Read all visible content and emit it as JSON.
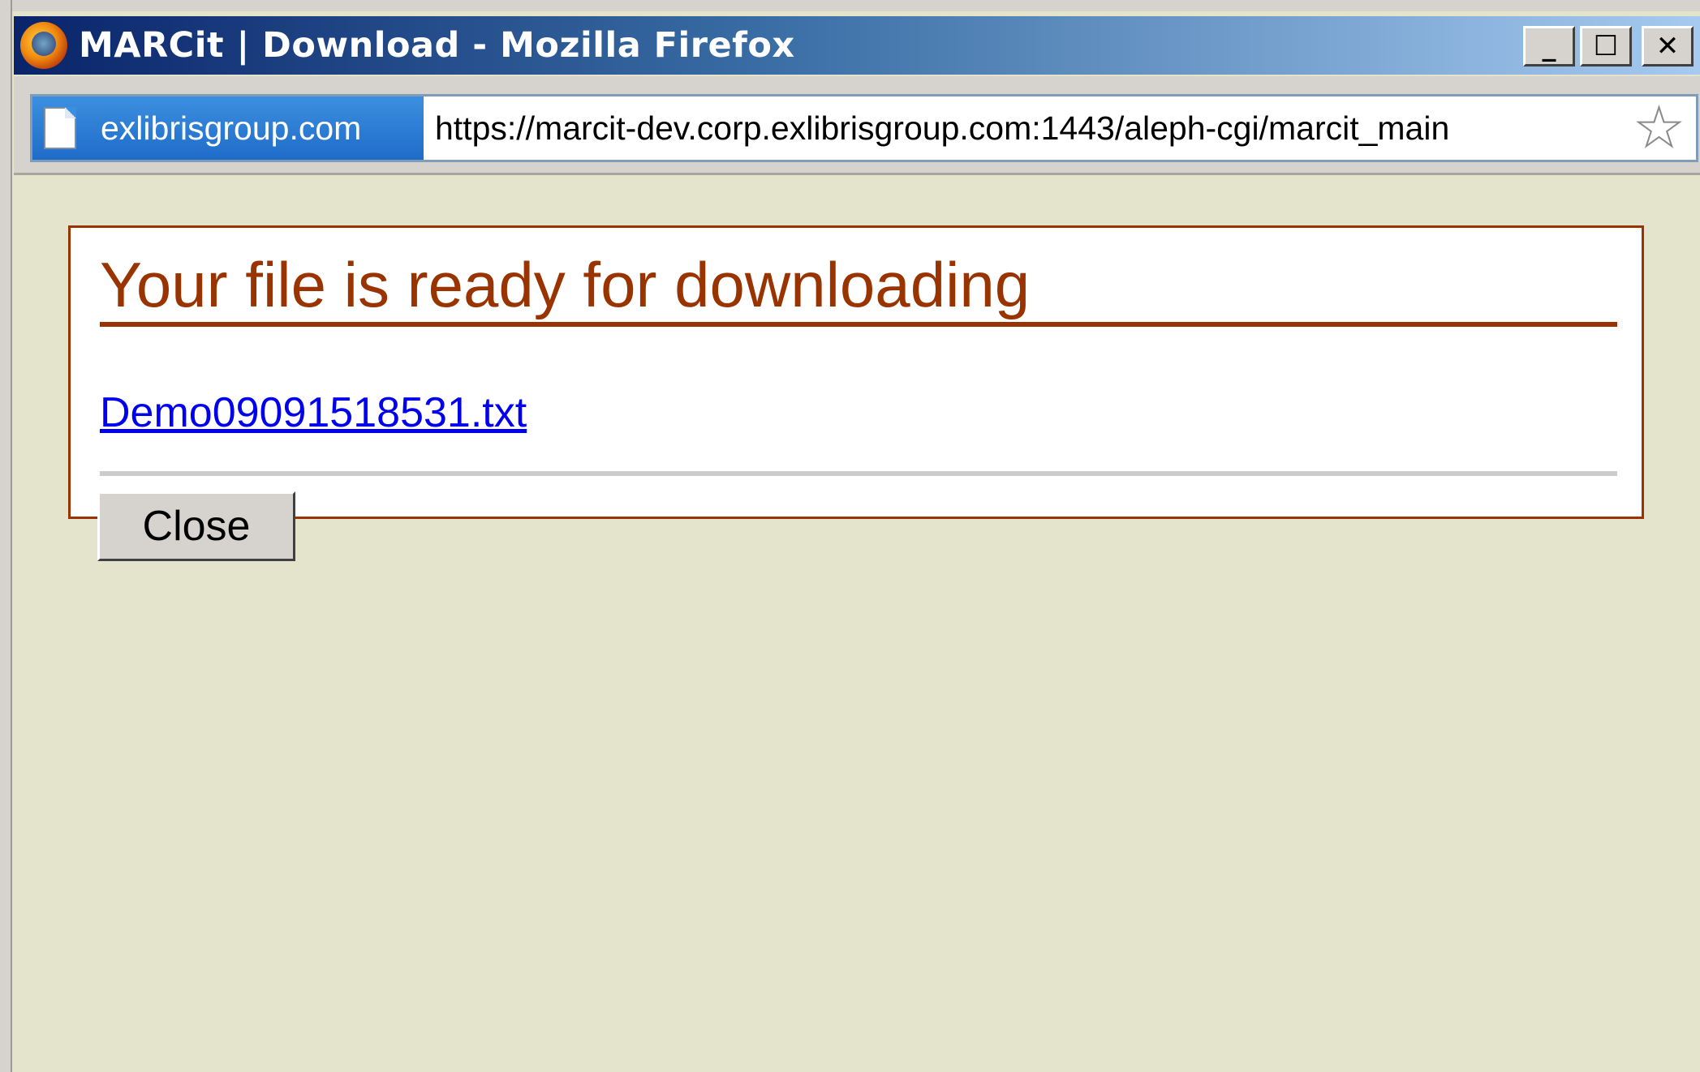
{
  "window": {
    "title": "MARCit | Download - Mozilla Firefox",
    "controls": {
      "minimize": "_",
      "maximize": "☐",
      "close": "✕"
    }
  },
  "address_bar": {
    "site_identity": "exlibrisgroup.com",
    "url": "https://marcit-dev.corp.exlibrisgroup.com:1443/aleph-cgi/marcit_main"
  },
  "page": {
    "heading": "Your file is ready for downloading",
    "file_link": "Demo09091518531.txt",
    "close_label": "Close"
  },
  "colors": {
    "accent": "#993300",
    "link": "#0000ee",
    "page_background": "#e4e4cc"
  },
  "icons": [
    "firefox-logo-icon",
    "page-icon",
    "bookmark-star-icon"
  ]
}
